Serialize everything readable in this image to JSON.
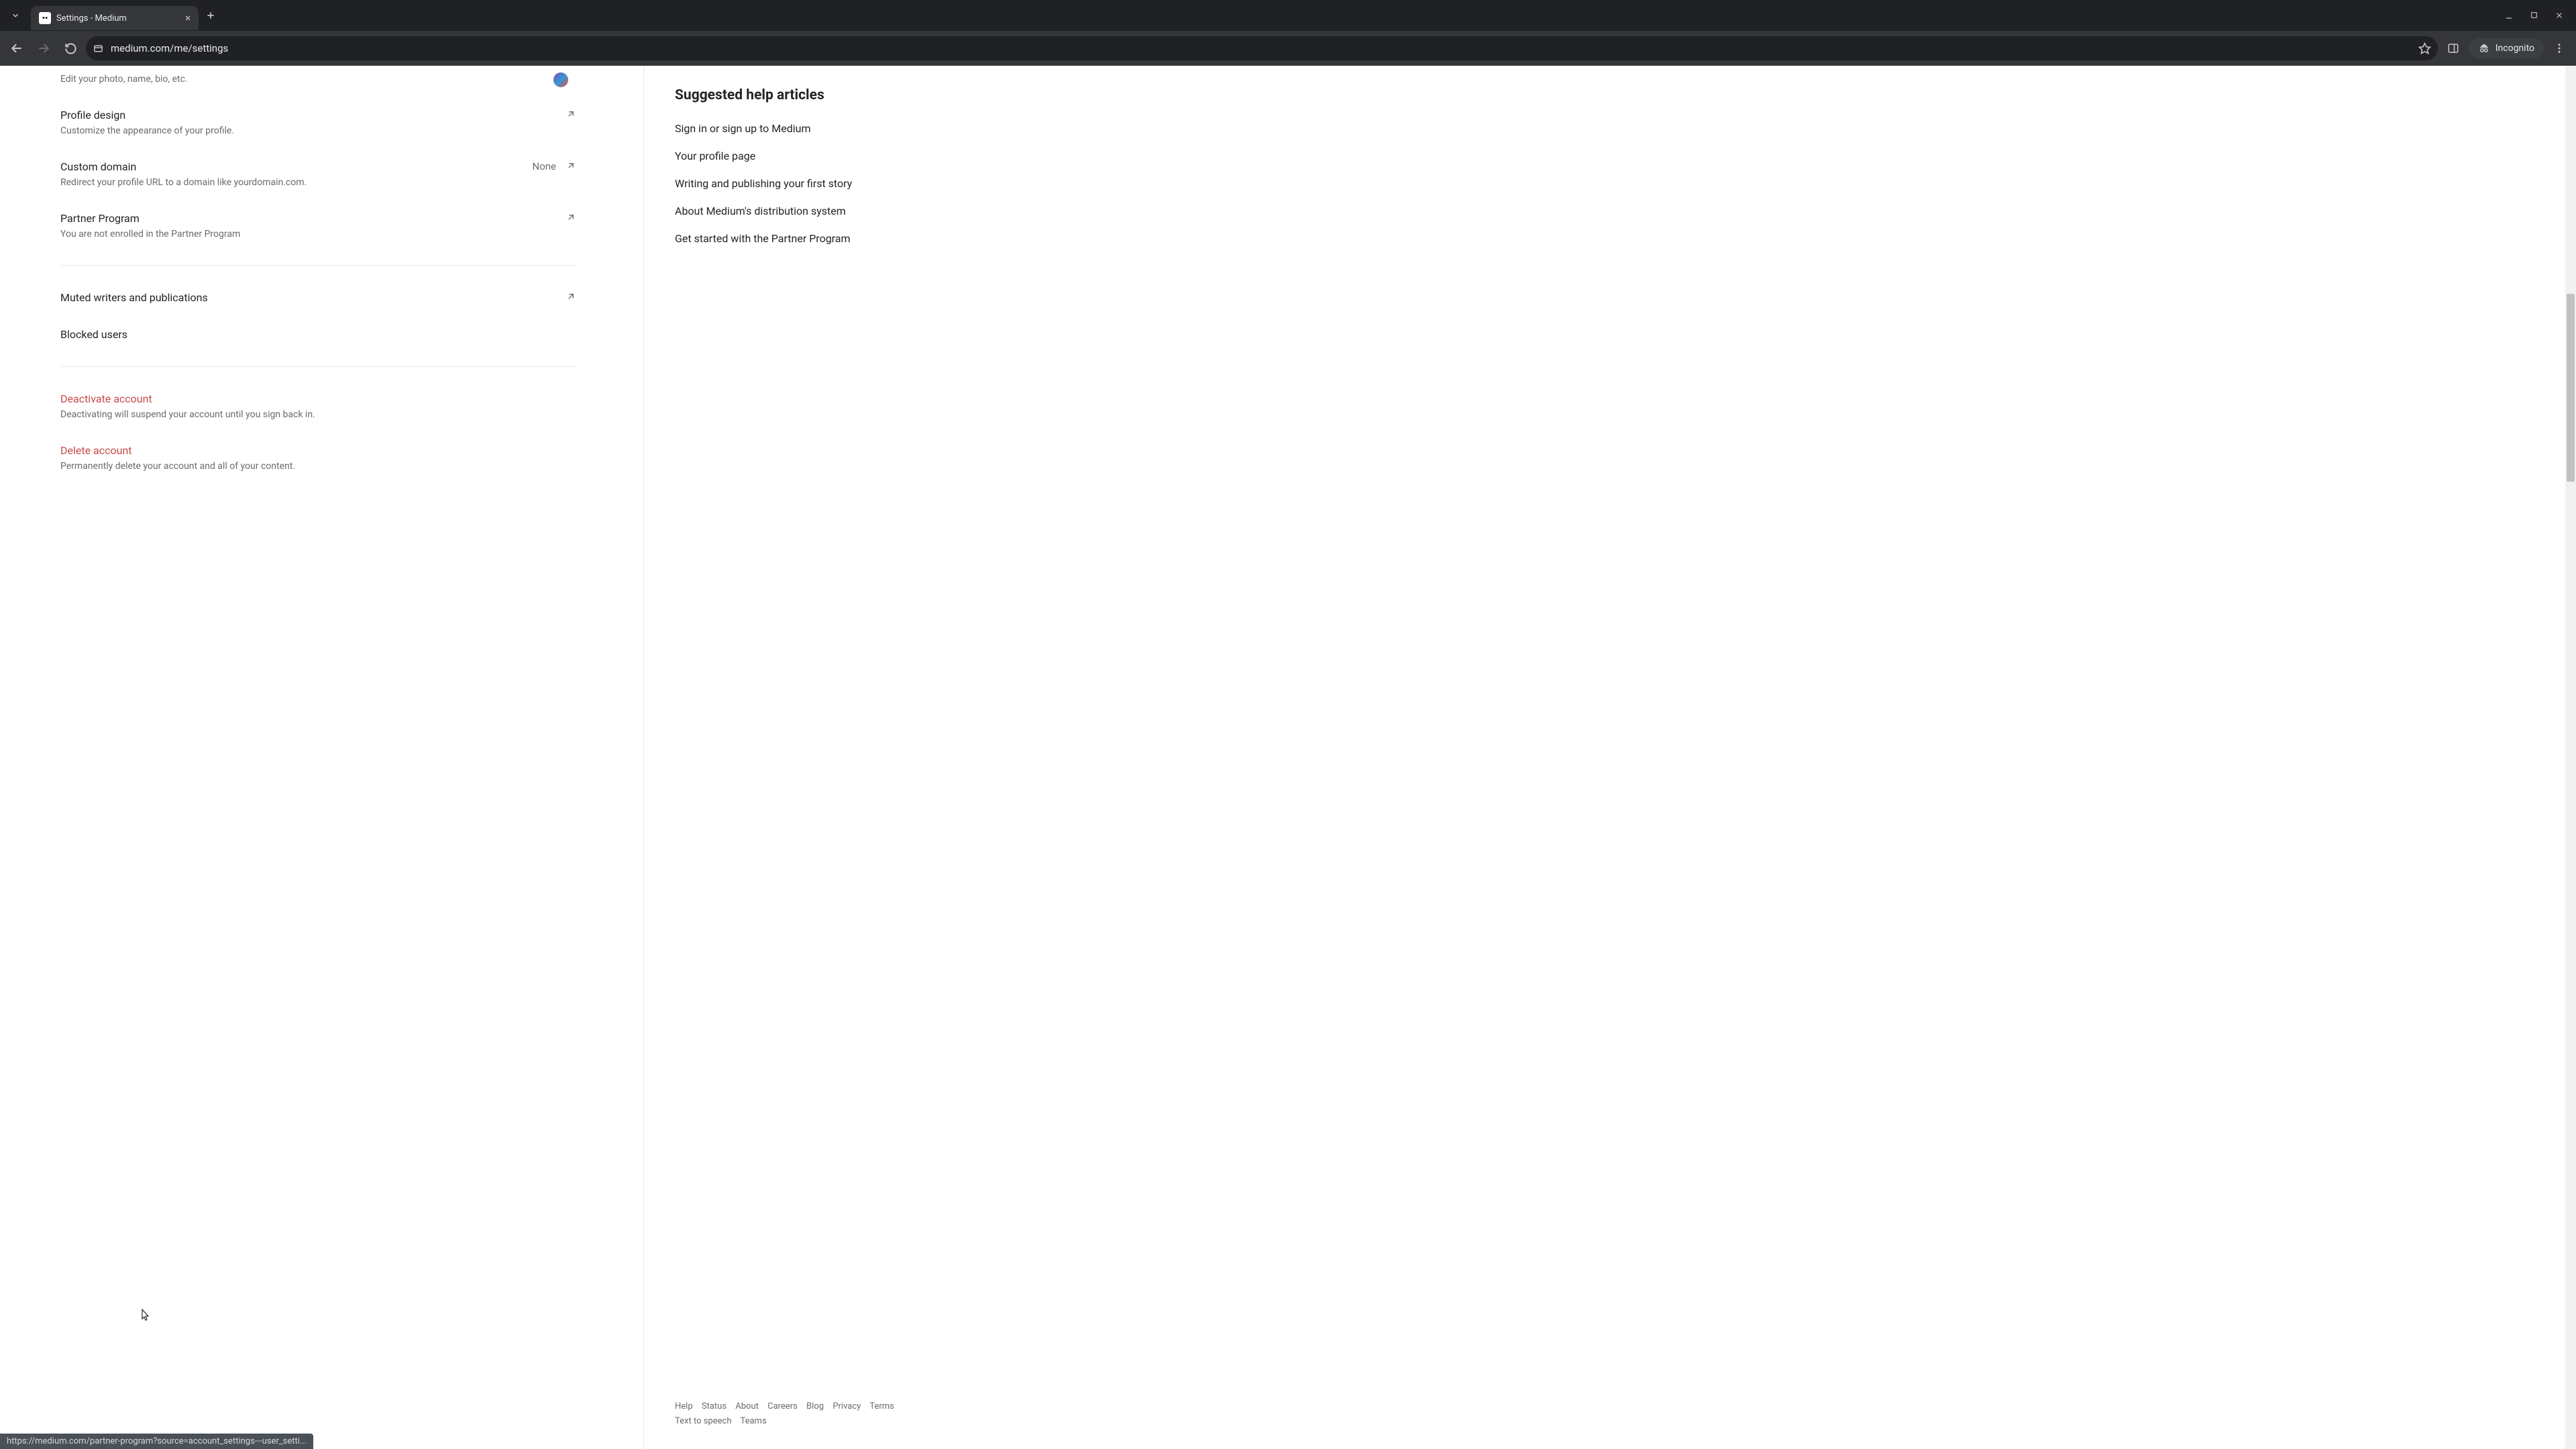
{
  "browser": {
    "tab_title": "Settings - Medium",
    "url": "medium.com/me/settings",
    "incognito_label": "Incognito",
    "status_bar": "https://medium.com/partner-program?source=account_settings---user_setti..."
  },
  "settings": {
    "profile_edit_desc": "Edit your photo, name, bio, etc.",
    "profile_design": {
      "title": "Profile design",
      "desc": "Customize the appearance of your profile."
    },
    "custom_domain": {
      "title": "Custom domain",
      "desc": "Redirect your profile URL to a domain like yourdomain.com.",
      "value": "None"
    },
    "partner": {
      "title": "Partner Program",
      "desc": "You are not enrolled in the Partner Program"
    },
    "muted": {
      "title": "Muted writers and publications"
    },
    "blocked": {
      "title": "Blocked users"
    },
    "deactivate": {
      "title": "Deactivate account",
      "desc": "Deactivating will suspend your account until you sign back in."
    },
    "delete": {
      "title": "Delete account",
      "desc": "Permanently delete your account and all of your content."
    }
  },
  "sidebar": {
    "heading": "Suggested help articles",
    "links": [
      "Sign in or sign up to Medium",
      "Your profile page",
      "Writing and publishing your first story",
      "About Medium's distribution system",
      "Get started with the Partner Program"
    ]
  },
  "footer": {
    "row1": [
      "Help",
      "Status",
      "About",
      "Careers",
      "Blog",
      "Privacy",
      "Terms"
    ],
    "row2": [
      "Text to speech",
      "Teams"
    ]
  }
}
